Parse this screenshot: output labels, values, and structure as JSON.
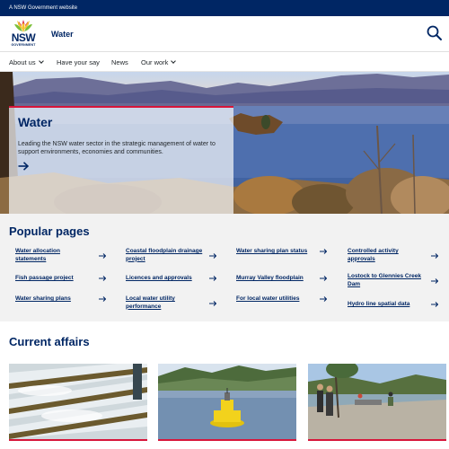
{
  "gov_bar": {
    "text": "A NSW Government website"
  },
  "header": {
    "logo_text": "NSW",
    "logo_subtext": "GOVERNMENT",
    "site_title": "Water",
    "search_icon": "search-icon"
  },
  "nav": {
    "items": [
      {
        "label": "About us",
        "has_dropdown": true
      },
      {
        "label": "Have your say",
        "has_dropdown": false
      },
      {
        "label": "News",
        "has_dropdown": false
      },
      {
        "label": "Our work",
        "has_dropdown": true
      }
    ]
  },
  "hero": {
    "title": "Water",
    "description": "Leading the NSW water sector in the strategic management of water to support environments, economies and communities.",
    "arrow_icon": "arrow-right-icon"
  },
  "popular": {
    "title": "Popular pages",
    "links": [
      "Water allocation statements",
      "Coastal floodplain drainage project",
      "Water sharing plan status",
      "Controlled activity approvals",
      "Fish passage project",
      "Licences and approvals",
      "Murray Valley floodplain",
      "Lostock to Glennies Creek Dam",
      "Water sharing plans",
      "Local water utility performance",
      "For local water utilities",
      "Hydro line spatial data"
    ]
  },
  "current_affairs": {
    "title": "Current affairs"
  },
  "colors": {
    "navy": "#002664",
    "accent_red": "#d7153a",
    "section_bg": "#f2f2f2"
  }
}
